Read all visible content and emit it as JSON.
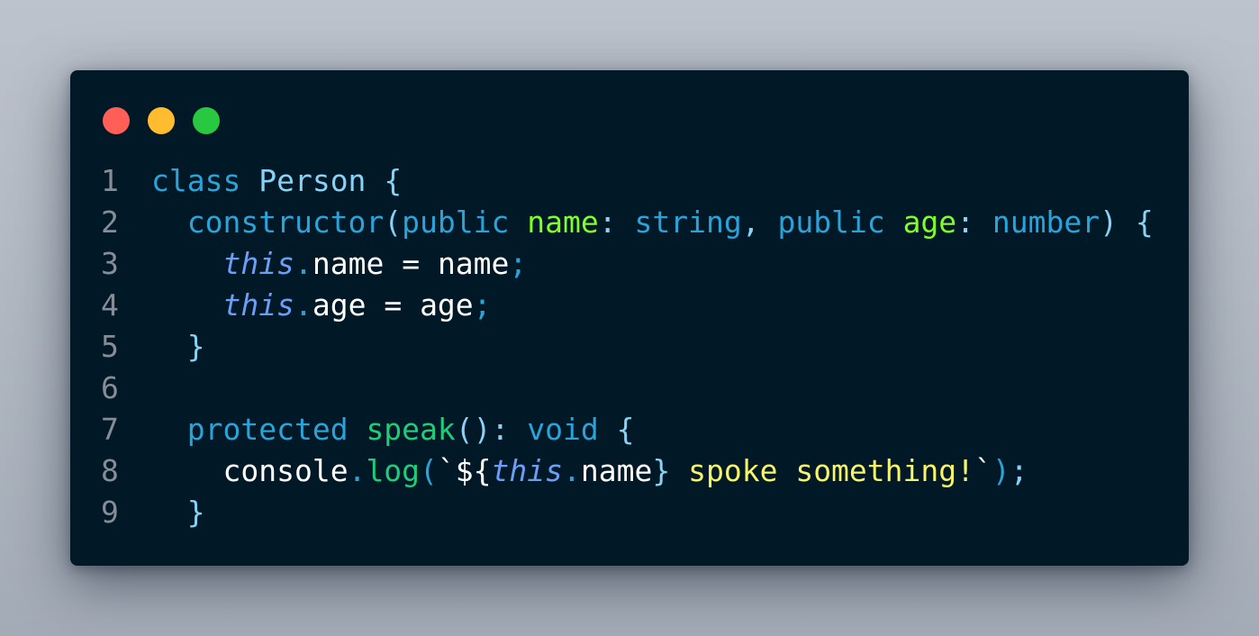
{
  "window": {
    "traffic_lights": [
      "close",
      "minimize",
      "maximize"
    ]
  },
  "code": {
    "lines": [
      {
        "number": "1",
        "tokens": [
          {
            "t": "class",
            "c": "kw"
          },
          {
            "t": " ",
            "c": "plain"
          },
          {
            "t": "Person",
            "c": "cls"
          },
          {
            "t": " ",
            "c": "plain"
          },
          {
            "t": "{",
            "c": "pn"
          }
        ]
      },
      {
        "number": "2",
        "tokens": [
          {
            "t": "  ",
            "c": "plain"
          },
          {
            "t": "constructor",
            "c": "kw"
          },
          {
            "t": "(",
            "c": "pn"
          },
          {
            "t": "public",
            "c": "kw"
          },
          {
            "t": " ",
            "c": "plain"
          },
          {
            "t": "name",
            "c": "param"
          },
          {
            "t": ":",
            "c": "pn"
          },
          {
            "t": " ",
            "c": "plain"
          },
          {
            "t": "string",
            "c": "kw"
          },
          {
            "t": ",",
            "c": "pn"
          },
          {
            "t": " ",
            "c": "plain"
          },
          {
            "t": "public",
            "c": "kw"
          },
          {
            "t": " ",
            "c": "plain"
          },
          {
            "t": "age",
            "c": "param"
          },
          {
            "t": ":",
            "c": "pn"
          },
          {
            "t": " ",
            "c": "plain"
          },
          {
            "t": "number",
            "c": "kw"
          },
          {
            "t": ")",
            "c": "pn"
          },
          {
            "t": " ",
            "c": "plain"
          },
          {
            "t": "{",
            "c": "pn"
          }
        ]
      },
      {
        "number": "3",
        "tokens": [
          {
            "t": "    ",
            "c": "plain"
          },
          {
            "t": "this",
            "c": "this"
          },
          {
            "t": ".",
            "c": "kw"
          },
          {
            "t": "name",
            "c": "plain"
          },
          {
            "t": " = ",
            "c": "op"
          },
          {
            "t": "name",
            "c": "plain"
          },
          {
            "t": ";",
            "c": "semi"
          }
        ]
      },
      {
        "number": "4",
        "tokens": [
          {
            "t": "    ",
            "c": "plain"
          },
          {
            "t": "this",
            "c": "this"
          },
          {
            "t": ".",
            "c": "kw"
          },
          {
            "t": "age",
            "c": "plain"
          },
          {
            "t": " = ",
            "c": "op"
          },
          {
            "t": "age",
            "c": "plain"
          },
          {
            "t": ";",
            "c": "semi"
          }
        ]
      },
      {
        "number": "5",
        "tokens": [
          {
            "t": "  ",
            "c": "plain"
          },
          {
            "t": "}",
            "c": "pn"
          }
        ]
      },
      {
        "number": "6",
        "tokens": []
      },
      {
        "number": "7",
        "tokens": [
          {
            "t": "  ",
            "c": "plain"
          },
          {
            "t": "protected",
            "c": "kw"
          },
          {
            "t": " ",
            "c": "plain"
          },
          {
            "t": "speak",
            "c": "fn"
          },
          {
            "t": "():",
            "c": "pn"
          },
          {
            "t": " ",
            "c": "plain"
          },
          {
            "t": "void",
            "c": "kw"
          },
          {
            "t": " ",
            "c": "plain"
          },
          {
            "t": "{",
            "c": "pn"
          }
        ]
      },
      {
        "number": "8",
        "tokens": [
          {
            "t": "    ",
            "c": "plain"
          },
          {
            "t": "console",
            "c": "plain"
          },
          {
            "t": ".",
            "c": "kw"
          },
          {
            "t": "log",
            "c": "fn"
          },
          {
            "t": "(",
            "c": "kw"
          },
          {
            "t": "`${",
            "c": "tick"
          },
          {
            "t": "this",
            "c": "this"
          },
          {
            "t": ".",
            "c": "kw"
          },
          {
            "t": "name",
            "c": "plain"
          },
          {
            "t": "}",
            "c": "pn"
          },
          {
            "t": " spoke something!",
            "c": "str"
          },
          {
            "t": "`",
            "c": "tick"
          },
          {
            "t": ")",
            "c": "kw"
          },
          {
            "t": ";",
            "c": "pn"
          }
        ]
      },
      {
        "number": "9",
        "tokens": [
          {
            "t": "  ",
            "c": "plain"
          },
          {
            "t": "}",
            "c": "pn"
          }
        ]
      }
    ]
  }
}
